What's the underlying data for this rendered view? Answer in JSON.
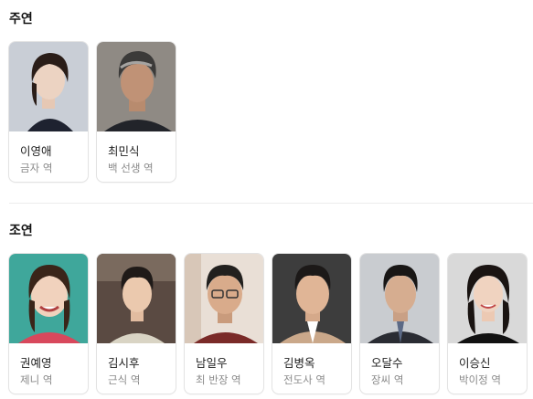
{
  "sections": {
    "lead": {
      "title": "주연",
      "cast": [
        {
          "name": "이영애",
          "role": "금자 역"
        },
        {
          "name": "최민식",
          "role": "백 선생 역"
        }
      ]
    },
    "supporting": {
      "title": "조연",
      "cast": [
        {
          "name": "권예영",
          "role": "제니 역"
        },
        {
          "name": "김시후",
          "role": "근식 역"
        },
        {
          "name": "남일우",
          "role": "최 반장 역"
        },
        {
          "name": "김병옥",
          "role": "전도사 역"
        },
        {
          "name": "오달수",
          "role": "장씨 역"
        },
        {
          "name": "이승신",
          "role": "박이정 역"
        }
      ]
    }
  }
}
